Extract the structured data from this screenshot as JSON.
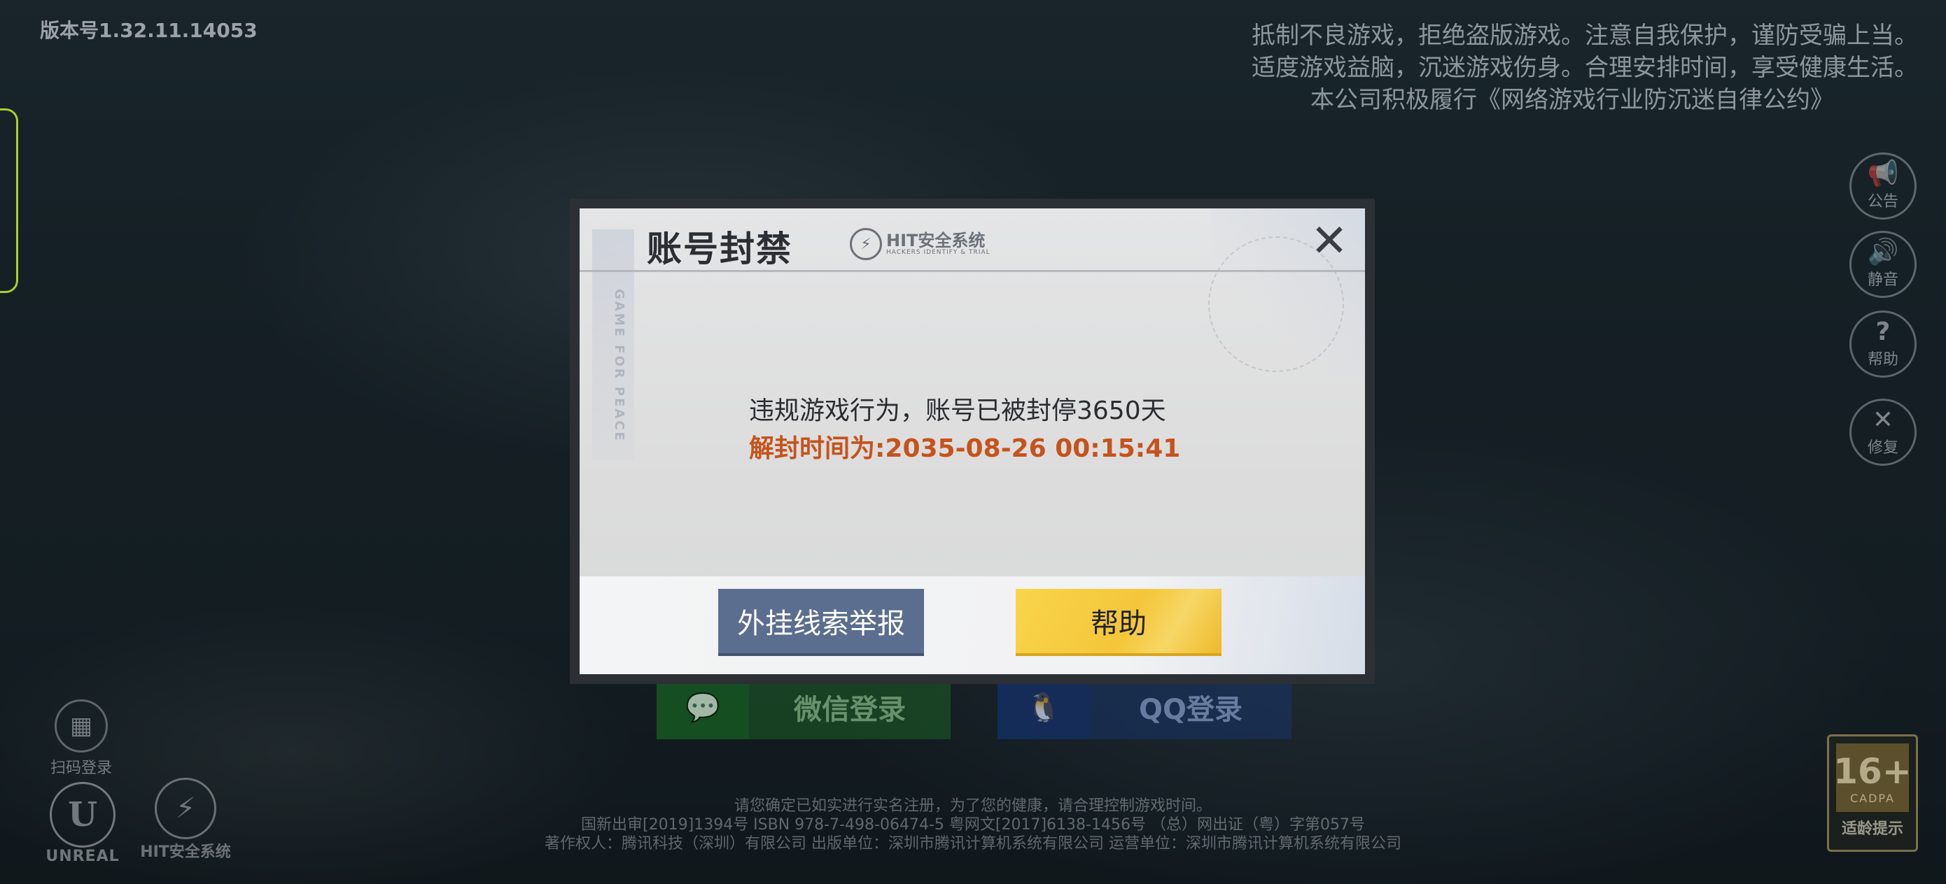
{
  "version": "版本号1.32.11.14053",
  "notice": [
    "抵制不良游戏，拒绝盗版游戏。注意自我保护，谨防受骗上当。",
    "适度游戏益脑，沉迷游戏伤身。合理安排时间，享受健康生活。",
    "本公司积极履行《网络游戏行业防沉迷自律公约》"
  ],
  "side_buttons": [
    {
      "icon": "megaphone-icon",
      "glyph": "📢",
      "label": "公告"
    },
    {
      "icon": "speaker-icon",
      "glyph": "🔊",
      "label": "静音"
    },
    {
      "icon": "question-icon",
      "glyph": "?",
      "label": "帮助"
    },
    {
      "icon": "wrench-icon",
      "glyph": "✕",
      "label": "修复"
    }
  ],
  "login": {
    "wechat_label": "微信登录",
    "qq_label": "QQ登录",
    "qr_label": "扫码登录"
  },
  "logos": {
    "unreal": "UNREAL",
    "hit": "HIT安全系统"
  },
  "footer": [
    "请您确定已如实进行实名注册，为了您的健康，请合理控制游戏时间。",
    "国新出审[2019]1394号  ISBN 978-7-498-06474-5  粤网文[2017]6138-1456号  （总）网出证（粤）字第057号",
    "著作权人：腾讯科技（深圳）有限公司  出版单位：深圳市腾讯计算机系统有限公司  运营单位：深圳市腾讯计算机系统有限公司"
  ],
  "age_rating": {
    "value": "16+",
    "org": "CADPA",
    "label": "适龄提示"
  },
  "dialog": {
    "title": "账号封禁",
    "brand": "HIT安全系统",
    "brand_sub": "HACKERS IDENTIFY & TRIAL",
    "side_text": "GAME FOR PEACE",
    "message": "违规游戏行为，账号已被封停3650天",
    "unban_time": "解封时间为:2035-08-26 00:15:41",
    "report_button": "外挂线索举报",
    "help_button": "帮助",
    "close_icon": "close-icon"
  },
  "colors": {
    "accent_yellow": "#f4c63a",
    "report_blue": "#5b6e8f",
    "warning_orange": "#c6531c",
    "wechat_green": "#1e6e28",
    "qq_blue": "#19377a"
  }
}
